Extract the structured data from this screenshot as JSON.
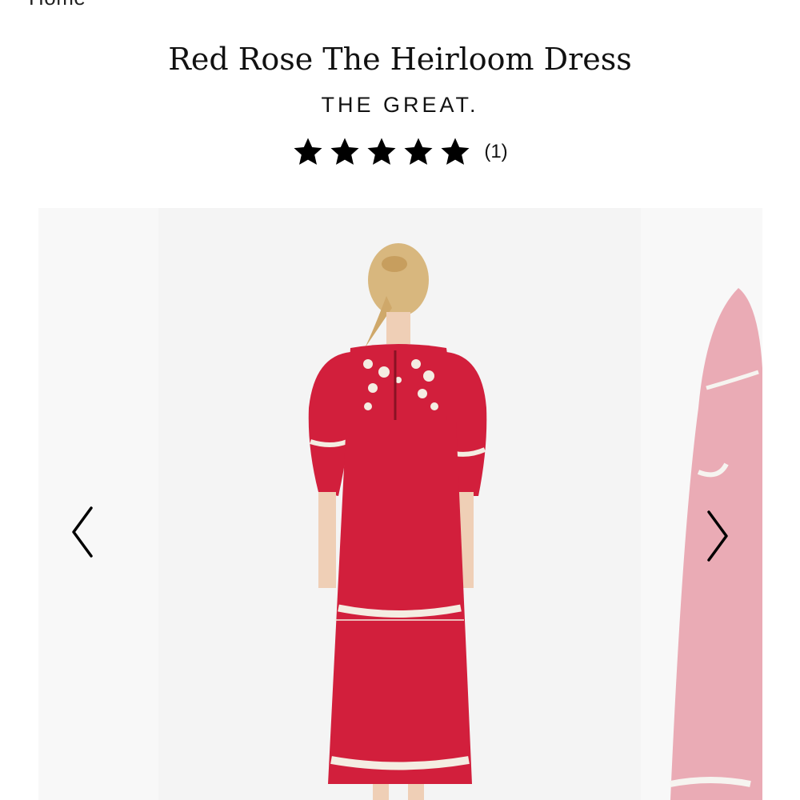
{
  "breadcrumb": {
    "label": "Home"
  },
  "product": {
    "title": "Red Rose The Heirloom Dress",
    "brand": "THE GREAT.",
    "rating": {
      "stars": 5,
      "review_count": "(1)"
    }
  },
  "gallery": {
    "main_image": "red embroidered midi dress, back view",
    "next_image": "red embroidered midi dress, partial",
    "prev_icon": "chevron-left-icon",
    "next_icon": "chevron-right-icon"
  },
  "colors": {
    "dress": "#d21f3c",
    "embroidery": "#f4ede2",
    "background": "#f4f4f4"
  }
}
